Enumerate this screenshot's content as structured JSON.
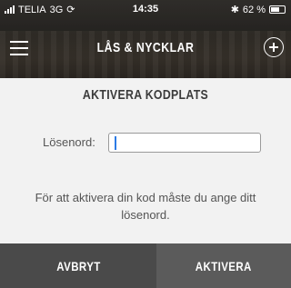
{
  "status_bar": {
    "carrier": "TELIA",
    "network": "3G",
    "time": "14:35",
    "battery_text": "62 %",
    "battery_level": 0.62,
    "icons": [
      "signal-icon",
      "activity-icon",
      "bluetooth-icon",
      "battery-icon"
    ]
  },
  "navbar": {
    "title": "LÅS & NYCKLAR",
    "left_icon": "hamburger-menu-icon",
    "right_icon": "plus-circle-icon"
  },
  "dialog": {
    "heading": "AKTIVERA KODPLATS",
    "password_label": "Lösenord:",
    "password_value": "",
    "description": "För att aktivera din kod måste du ange ditt lösenord."
  },
  "buttons": {
    "cancel": "AVBRYT",
    "activate": "AKTIVERA"
  }
}
